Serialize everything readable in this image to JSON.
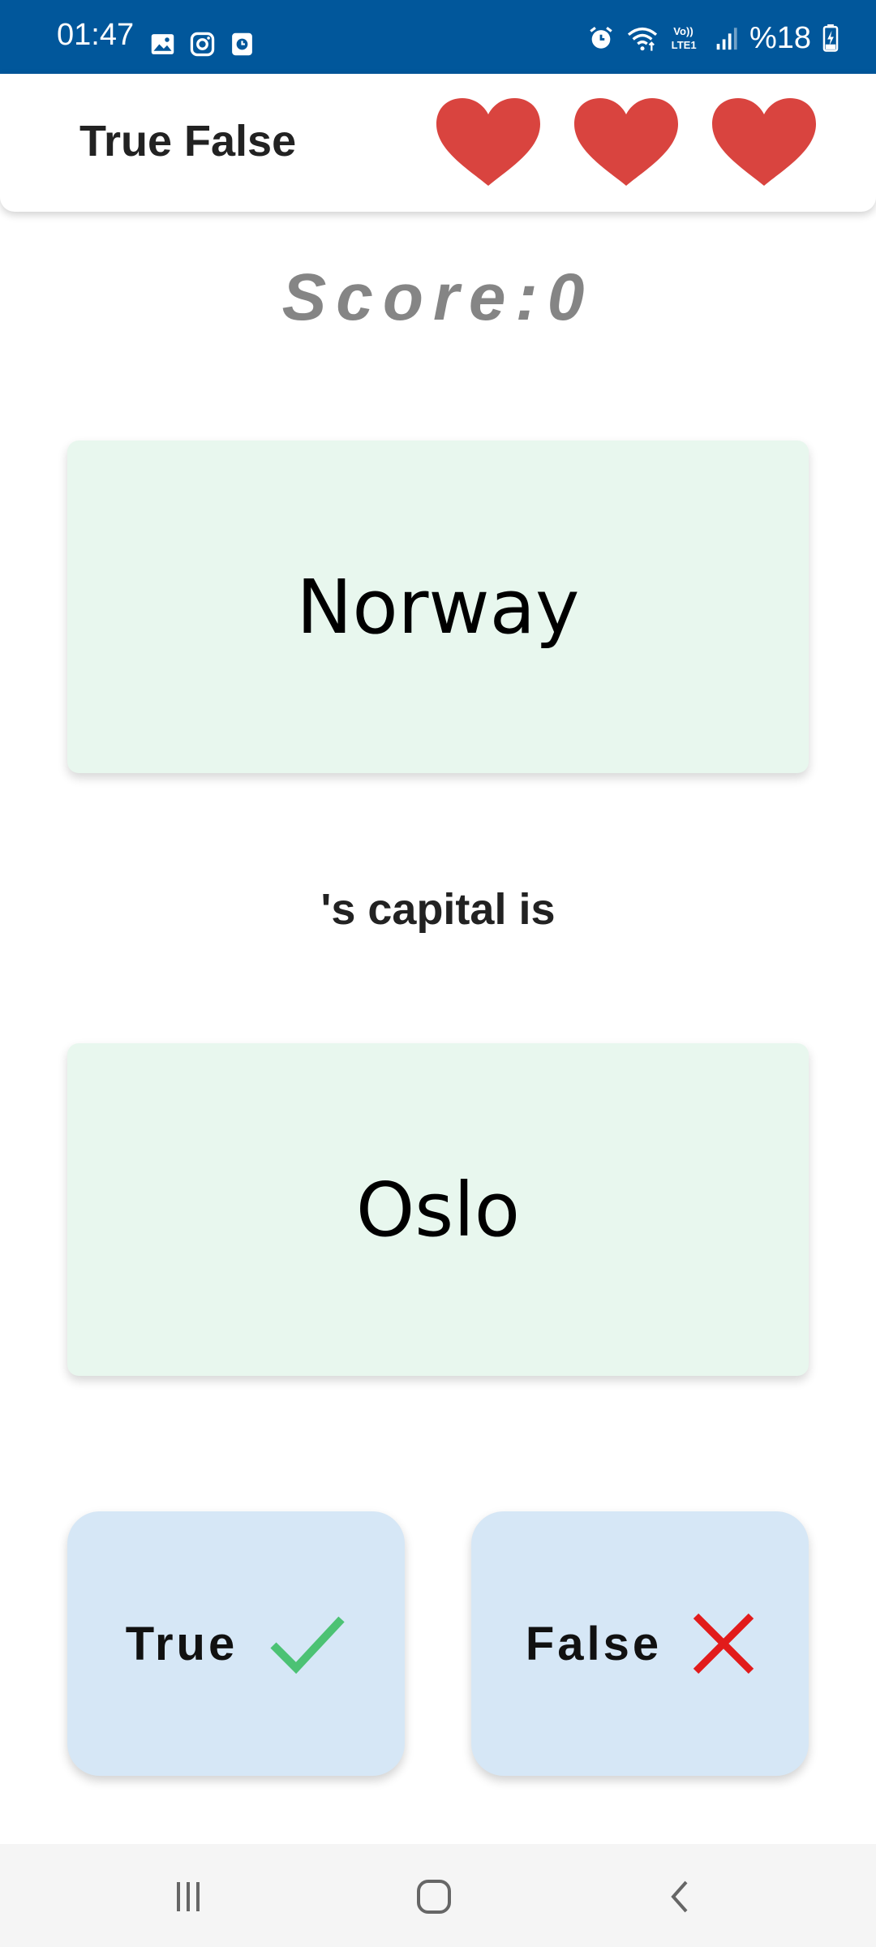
{
  "status_bar": {
    "time": "01:47",
    "battery": "%18",
    "left_icons": [
      "gallery-icon",
      "instagram-icon",
      "app-notification-icon"
    ],
    "right_icons": [
      "alarm-icon",
      "wifi-icon",
      "volte-lte-icon",
      "signal-icon",
      "battery-charging-icon"
    ],
    "lte_label": "Vo))\nLTE1",
    "background": "#01579b"
  },
  "app_bar": {
    "title": "True False",
    "lives": 3,
    "heart_color": "#d9443f"
  },
  "score": {
    "text": "Score:0"
  },
  "question": {
    "country": "Norway",
    "connector": "'s capital is",
    "capital": "Oslo",
    "card_color": "#e8f7ee"
  },
  "answers": {
    "true_label": "True",
    "false_label": "False",
    "true_icon": "check-icon",
    "false_icon": "cross-icon",
    "check_color": "#4cc274",
    "cross_color": "#e21b1b",
    "button_color": "#d6e7f6"
  },
  "nav": {
    "items": [
      "recents-button",
      "home-button",
      "back-button"
    ]
  }
}
